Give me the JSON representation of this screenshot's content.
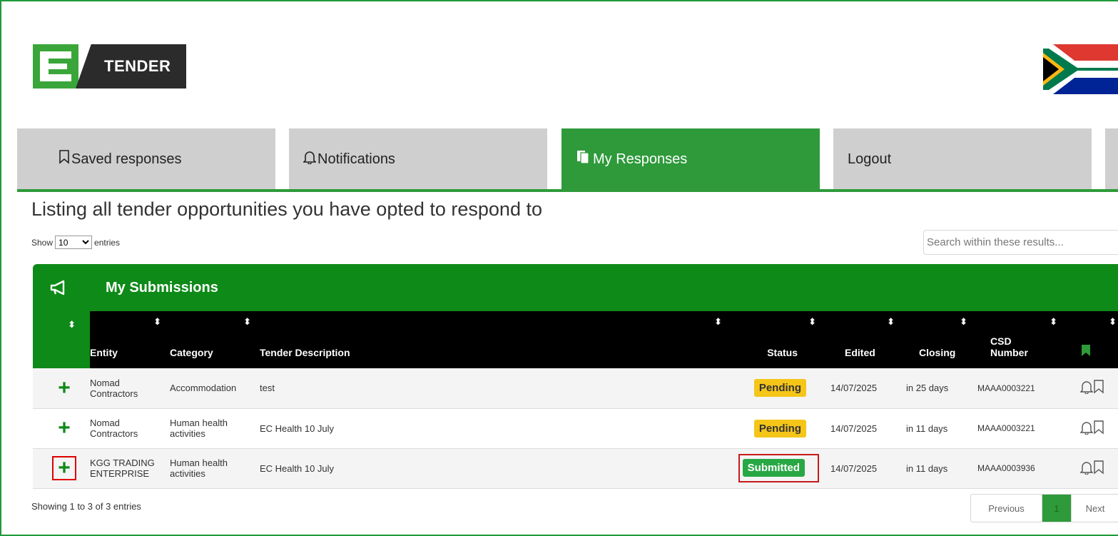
{
  "logo": {
    "text": "TENDER"
  },
  "nav": {
    "tabs": [
      {
        "label": "Saved responses",
        "icon": "bookmark-outline-icon"
      },
      {
        "label": "Notifications",
        "icon": "bell-outline-icon"
      },
      {
        "label": "My Responses",
        "icon": "documents-icon",
        "active": true
      },
      {
        "label": "Logout"
      }
    ]
  },
  "page": {
    "title": "Listing all tender opportunities you have opted to respond to"
  },
  "entries": {
    "show_label": "Show",
    "value": "10",
    "suffix": "entries"
  },
  "search": {
    "placeholder": "Search within these results..."
  },
  "panel": {
    "title": "My Submissions",
    "icon": "megaphone-icon"
  },
  "table": {
    "columns": [
      "Entity",
      "Category",
      "Tender Description",
      "Status",
      "Edited",
      "Closing",
      "CSD Number"
    ],
    "rows": [
      {
        "entity": "Nomad Contractors",
        "category": "Accommodation",
        "description": "test",
        "status": "Pending",
        "edited": "14/07/2025",
        "closing": "in 25 days",
        "csd": "MAAA0003221"
      },
      {
        "entity": "Nomad Contractors",
        "category": "Human health activities",
        "description": "EC Health 10 July",
        "status": "Pending",
        "edited": "14/07/2025",
        "closing": "in 11 days",
        "csd": "MAAA0003221"
      },
      {
        "entity": "KGG TRADING ENTERPRISE",
        "category": "Human health activities",
        "description": "EC Health 10 July",
        "status": "Submitted",
        "edited": "14/07/2025",
        "closing": "in 11 days",
        "csd": "MAAA0003936"
      }
    ]
  },
  "footer": {
    "showing": "Showing 1 to 3 of 3 entries"
  },
  "pagination": {
    "previous": "Previous",
    "current": "1",
    "next": "Next"
  },
  "colors": {
    "brand_green": "#2e9a3a",
    "panel_green": "#0e8a18",
    "pending": "#f5c518",
    "submitted": "#28a745",
    "highlight": "#c91a1a"
  }
}
